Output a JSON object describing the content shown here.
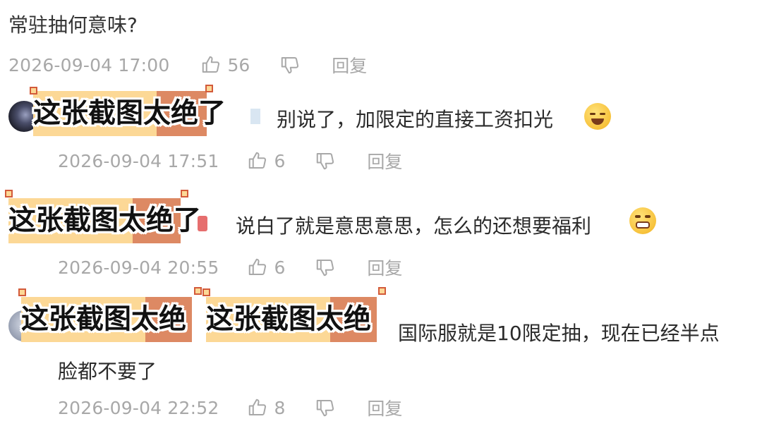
{
  "top_comment": {
    "text": "常驻抽何意味?",
    "time": "2026-09-04 17:00",
    "likes": "56",
    "reply_label": "回复"
  },
  "replies": [
    {
      "text": "别说了，加限定的直接工资扣光",
      "time": "2026-09-04 17:51",
      "likes": "6",
      "reply_label": "回复",
      "sticker": "这张截图太绝了"
    },
    {
      "text": "说白了就是意思意思，怎么的还想要福利",
      "time": "2026-09-04 20:55",
      "likes": "6",
      "reply_label": "回复",
      "sticker": "这张截图太绝了"
    },
    {
      "text_line1": "国际服就是10限定抽，现在已经半点",
      "text_line2": "脸都不要了",
      "time": "2026-09-04 22:52",
      "likes": "8",
      "reply_label": "回复",
      "sticker_a": "这张截图太绝",
      "sticker_b": "这张截图太绝"
    }
  ],
  "icons": {
    "like": "thumbs-up-icon",
    "dislike": "thumbs-down-icon",
    "emoji_1": "crying-laughing-emoji",
    "emoji_2": "grinning-teeth-emoji"
  },
  "colors": {
    "meta_grey": "#a8a8a8",
    "sticker_yellow": "#fcd896",
    "sticker_orange": "#dd8963",
    "handle_border": "#d35a3a"
  }
}
